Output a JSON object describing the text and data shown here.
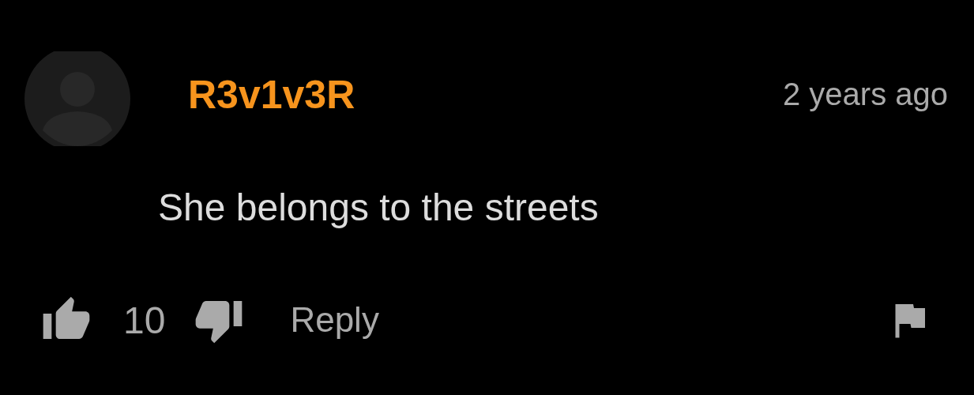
{
  "comment": {
    "author": "R3v1v3R",
    "time": "2 years ago",
    "text": "She belongs to the streets",
    "likes": "10",
    "reply": "Reply"
  }
}
